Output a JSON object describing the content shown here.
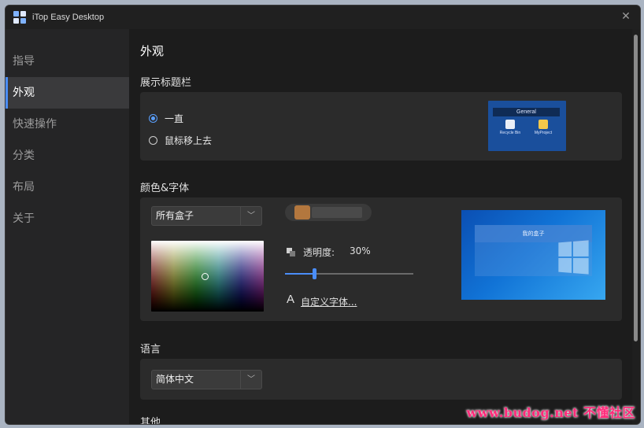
{
  "window": {
    "title": "iTop Easy Desktop",
    "close_icon": "close-icon"
  },
  "sidebar": {
    "items": [
      {
        "label": "指导",
        "active": false
      },
      {
        "label": "外观",
        "active": true
      },
      {
        "label": "快速操作",
        "active": false
      },
      {
        "label": "分类",
        "active": false
      },
      {
        "label": "布局",
        "active": false
      },
      {
        "label": "关于",
        "active": false
      }
    ]
  },
  "content": {
    "page_title": "外观",
    "titlebar_section": {
      "title": "展示标题栏",
      "options": [
        {
          "label": "一直",
          "checked": true
        },
        {
          "label": "鼠标移上去",
          "checked": false
        }
      ],
      "preview": {
        "header": "General",
        "icons": [
          "Recycle Bin",
          "MyProject"
        ]
      }
    },
    "color_font_section": {
      "title": "颜色&字体",
      "box_select": "所有盒子",
      "opacity_label": "透明度:",
      "opacity_value": "30%",
      "opacity_fraction": 0.23,
      "custom_font_icon": "A",
      "custom_font_link": "自定义字体...",
      "preview": {
        "box_title": "我的盒子"
      }
    },
    "language_section": {
      "title": "语言",
      "language_select": "简体中文"
    },
    "other_section": {
      "title": "其他"
    }
  },
  "watermark": "www.budog.net 不懂社区",
  "colors": {
    "accent": "#4a8df8",
    "sidebar_bg": "#252526",
    "content_bg": "#1c1c1c",
    "panel_bg": "#2b2b2b",
    "watermark": "#ff2a7a"
  }
}
